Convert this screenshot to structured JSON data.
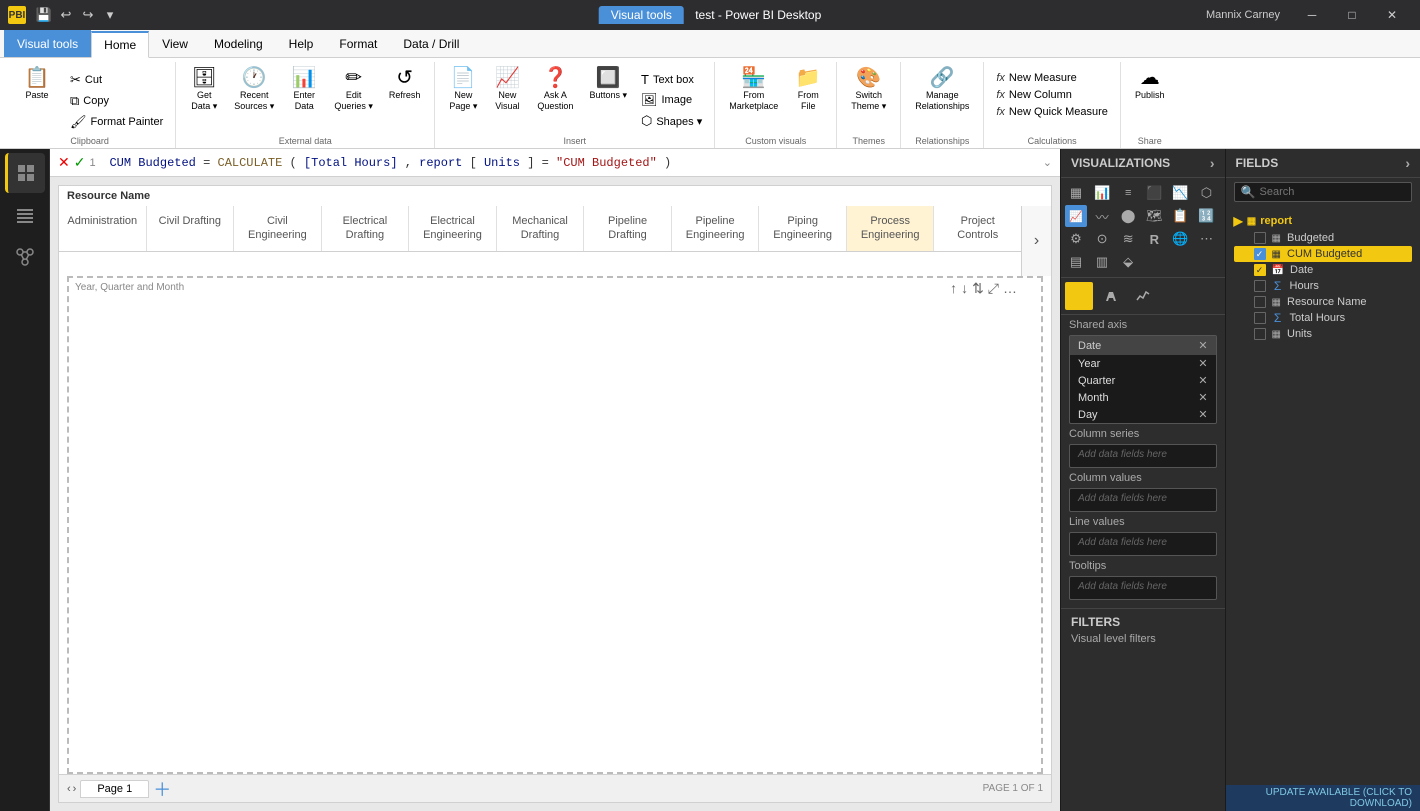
{
  "title_bar": {
    "logo": "PBI",
    "quick_access": [
      "save",
      "undo",
      "redo",
      "dropdown"
    ],
    "window_title": "test - Power BI Desktop",
    "active_tab": "Visual tools",
    "min": "─",
    "max": "□",
    "close": "✕",
    "user": "Mannix Carney"
  },
  "ribbon": {
    "tabs": [
      "Home",
      "View",
      "Modeling",
      "Help",
      "Format",
      "Data / Drill"
    ],
    "active_tab": "Home",
    "highlight_tab": "Visual tools",
    "groups": {
      "clipboard": {
        "label": "Clipboard",
        "buttons": [
          {
            "id": "paste",
            "icon": "📋",
            "label": "Paste"
          },
          {
            "id": "cut",
            "icon": "✂",
            "label": "Cut"
          },
          {
            "id": "copy",
            "icon": "⧉",
            "label": "Copy"
          },
          {
            "id": "format-painter",
            "icon": "🖌",
            "label": "Format Painter"
          }
        ]
      },
      "external_data": {
        "label": "External data",
        "buttons": [
          {
            "id": "get-data",
            "icon": "🗄",
            "label": "Get\nData"
          },
          {
            "id": "recent-sources",
            "icon": "🕐",
            "label": "Recent\nSources"
          },
          {
            "id": "enter-data",
            "icon": "📊",
            "label": "Enter\nData"
          },
          {
            "id": "edit-queries",
            "icon": "✏",
            "label": "Edit\nQueries"
          },
          {
            "id": "refresh",
            "icon": "↺",
            "label": "Refresh"
          }
        ]
      },
      "insert": {
        "label": "Insert",
        "buttons": [
          {
            "id": "new-page",
            "icon": "📄",
            "label": "New\nPage"
          },
          {
            "id": "new-visual",
            "icon": "📈",
            "label": "New\nVisual"
          },
          {
            "id": "ask-question",
            "icon": "❓",
            "label": "Ask A\nQuestion"
          },
          {
            "id": "buttons",
            "icon": "🔲",
            "label": "Buttons"
          }
        ],
        "small_buttons": [
          {
            "id": "text-box",
            "icon": "T",
            "label": "Text box"
          },
          {
            "id": "image",
            "icon": "🖼",
            "label": "Image"
          },
          {
            "id": "shapes",
            "icon": "⬡",
            "label": "Shapes"
          }
        ]
      },
      "custom_visuals": {
        "label": "Custom visuals",
        "buttons": [
          {
            "id": "from-marketplace",
            "icon": "🏪",
            "label": "From\nMarketplace"
          },
          {
            "id": "from-file",
            "icon": "📁",
            "label": "From\nFile"
          }
        ]
      },
      "themes": {
        "label": "Themes",
        "buttons": [
          {
            "id": "switch-theme",
            "icon": "🎨",
            "label": "Switch\nTheme"
          }
        ]
      },
      "relationships": {
        "label": "Relationships",
        "buttons": [
          {
            "id": "manage-relationships",
            "icon": "🔗",
            "label": "Manage\nRelationships"
          }
        ]
      },
      "calculations": {
        "label": "Calculations",
        "buttons": [
          {
            "id": "new-measure",
            "icon": "𝑓𝑥",
            "label": "New Measure"
          },
          {
            "id": "new-column",
            "icon": "𝑓𝑥",
            "label": "New Column"
          },
          {
            "id": "new-quick-measure",
            "icon": "𝑓𝑥",
            "label": "New Quick Measure"
          }
        ]
      },
      "share": {
        "label": "Share",
        "buttons": [
          {
            "id": "publish",
            "icon": "☁",
            "label": "Publish"
          }
        ]
      }
    }
  },
  "formula_bar": {
    "row_num": "1",
    "formula": "CUM Budgeted = CALCULATE([Total Hours], report[Units] = \"CUM Budgeted\")"
  },
  "canvas": {
    "resource_name_label": "Resource Name",
    "columns": [
      "Administration",
      "Civil Drafting",
      "Civil\nEngineering",
      "Electrical\nDrafting",
      "Electrical\nEngineering",
      "Mechanical\nDrafting",
      "Pipeline\nDrafting",
      "Pipeline\nEngineering",
      "Piping\nEngineering",
      "Process\nEngineering",
      "Project\nControls"
    ],
    "axis_label": "Year, Quarter and Month",
    "page": "Page 1",
    "status": "PAGE 1 OF 1"
  },
  "visualizations": {
    "title": "VISUALIZATIONS",
    "icons": [
      "▦",
      "📊",
      "≡",
      "⬛",
      "📉",
      "⬡",
      "📈",
      "〰",
      "⬤",
      "🗺",
      "📋",
      "🔢",
      "⚙",
      "⊙",
      "≋",
      "🅡",
      "🌐",
      "⋯",
      "▤",
      "▥",
      "⬙"
    ],
    "field_tabs": [
      {
        "id": "fields",
        "icon": "≡"
      },
      {
        "id": "format",
        "icon": "🖌"
      },
      {
        "id": "analytics",
        "icon": "📊"
      }
    ],
    "shared_axis": "Shared axis",
    "date_field": "Date",
    "date_items": [
      "Year",
      "Quarter",
      "Month",
      "Day"
    ],
    "column_series_label": "Column series",
    "column_series_placeholder": "Add data fields here",
    "column_values_label": "Column values",
    "column_values_placeholder": "Add data fields here",
    "line_values_label": "Line values",
    "line_values_placeholder": "Add data fields here",
    "tooltips_label": "Tooltips",
    "tooltips_placeholder": "Add data fields here"
  },
  "fields": {
    "title": "FIELDS",
    "search_placeholder": "Search",
    "table_name": "report",
    "items": [
      {
        "name": "Budgeted",
        "type": "checkbox",
        "checked": false
      },
      {
        "name": "CUM Budgeted",
        "type": "checkbox",
        "checked": true,
        "highlighted": true
      },
      {
        "name": "Date",
        "type": "date",
        "checked": true
      },
      {
        "name": "Hours",
        "type": "sigma",
        "checked": false
      },
      {
        "name": "Resource Name",
        "type": "checkbox",
        "checked": false
      },
      {
        "name": "Total Hours",
        "type": "sigma",
        "checked": false
      },
      {
        "name": "Units",
        "type": "checkbox",
        "checked": false
      }
    ]
  },
  "filters": {
    "title": "FILTERS",
    "visual_level_label": "Visual level filters"
  },
  "update_banner": "UPDATE AVAILABLE (CLICK TO DOWNLOAD)"
}
